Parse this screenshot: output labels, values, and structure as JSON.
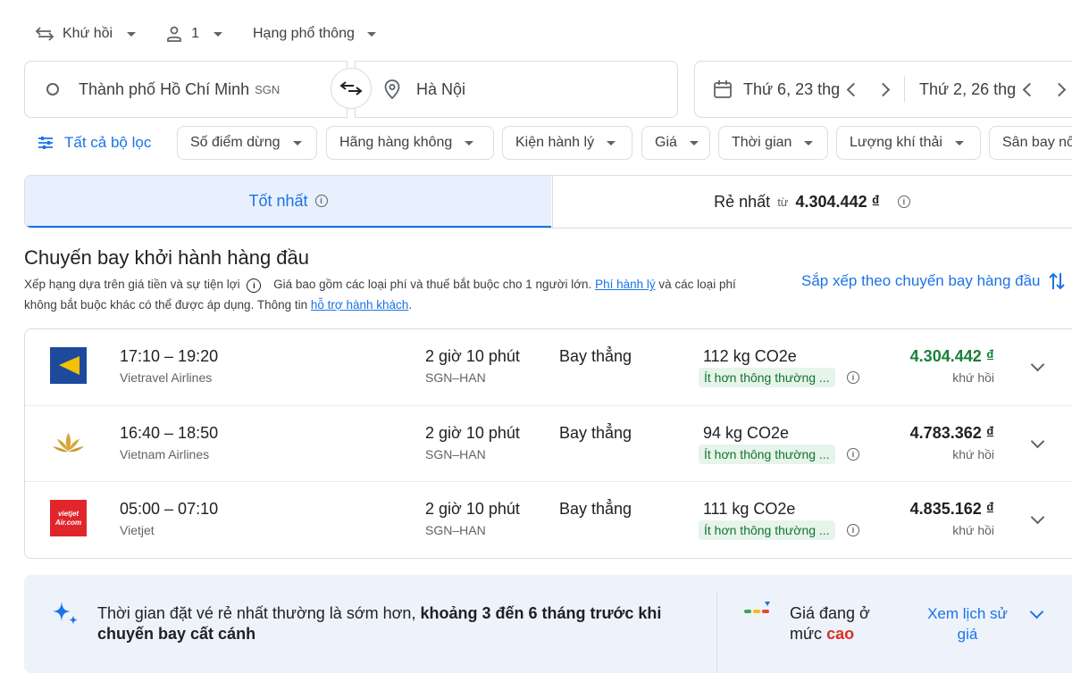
{
  "search": {
    "trip_type": "Khứ hồi",
    "passengers": "1",
    "cabin_class": "Hạng phổ thông",
    "origin": "Thành phố Hồ Chí Minh",
    "origin_code": "SGN",
    "destination": "Hà Nội",
    "depart_date": "Thứ 6, 23 thg",
    "return_date": "Thứ 2, 26 thg"
  },
  "filters": {
    "all": "Tất cả bộ lọc",
    "chips": [
      "Số điểm dừng",
      "Hãng hàng không",
      "Kiện hành lý",
      "Giá",
      "Thời gian",
      "Lượng khí thải",
      "Sân bay nố"
    ]
  },
  "tabs": {
    "best": "Tốt nhất",
    "cheapest": "Rẻ nhất",
    "cheapest_from": "từ",
    "cheapest_price": "4.304.442 ₫"
  },
  "section": {
    "title": "Chuyến bay khởi hành hàng đầu",
    "desc_part1": "Xếp hạng dựa trên giá tiền và sự tiện lợi",
    "desc_part2": "Giá bao gồm các loại phí và thuế bắt buộc cho 1 người lớn.",
    "desc_link1": "Phí hành lý",
    "desc_part3": "và các loại phí",
    "desc_line2": "không bắt buộc khác có thể được áp dụng. Thông tin",
    "desc_link2": "hỗ trợ hành khách",
    "desc_end": ".",
    "sort_label": "Sắp xếp theo chuyến bay hàng đầu"
  },
  "flights": [
    {
      "times": "17:10 – 19:20",
      "airline": "Vietravel Airlines",
      "duration": "2 giờ 10 phút",
      "route": "SGN–HAN",
      "stops": "Bay thẳng",
      "emissions": "112 kg CO2e",
      "eco_label": "Ít hơn thông thường ...",
      "price": "4.304.442 ₫",
      "price_note": "khứ hồi",
      "price_color": "#188038"
    },
    {
      "times": "16:40 – 18:50",
      "airline": "Vietnam Airlines",
      "duration": "2 giờ 10 phút",
      "route": "SGN–HAN",
      "stops": "Bay thẳng",
      "emissions": "94 kg CO2e",
      "eco_label": "Ít hơn thông thường ...",
      "price": "4.783.362 ₫",
      "price_note": "khứ hồi",
      "price_color": "#202124"
    },
    {
      "times": "05:00 – 07:10",
      "airline": "Vietjet",
      "duration": "2 giờ 10 phút",
      "route": "SGN–HAN",
      "stops": "Bay thẳng",
      "emissions": "111 kg CO2e",
      "eco_label": "Ít hơn thông thường ...",
      "price": "4.835.162 ₫",
      "price_note": "khứ hồi",
      "price_color": "#202124"
    }
  ],
  "vietjet_logo_text": "vietjet Air.com",
  "insight": {
    "text_normal": "Thời gian đặt vé rẻ nhất thường là sớm hơn,",
    "text_bold1": "khoảng 3 đến 6 tháng trước khi",
    "text_bold2": "chuyến bay cất cánh",
    "price_level_1": "Giá đang ở",
    "price_level_2": "mức",
    "price_level_value": "cao",
    "history_1": "Xem lịch sử",
    "history_2": "giá"
  },
  "colors": {
    "accent": "#1a73e8",
    "best_tab_bg": "#e8f0fe",
    "eco_green": "#137333",
    "high_red": "#d93025"
  }
}
